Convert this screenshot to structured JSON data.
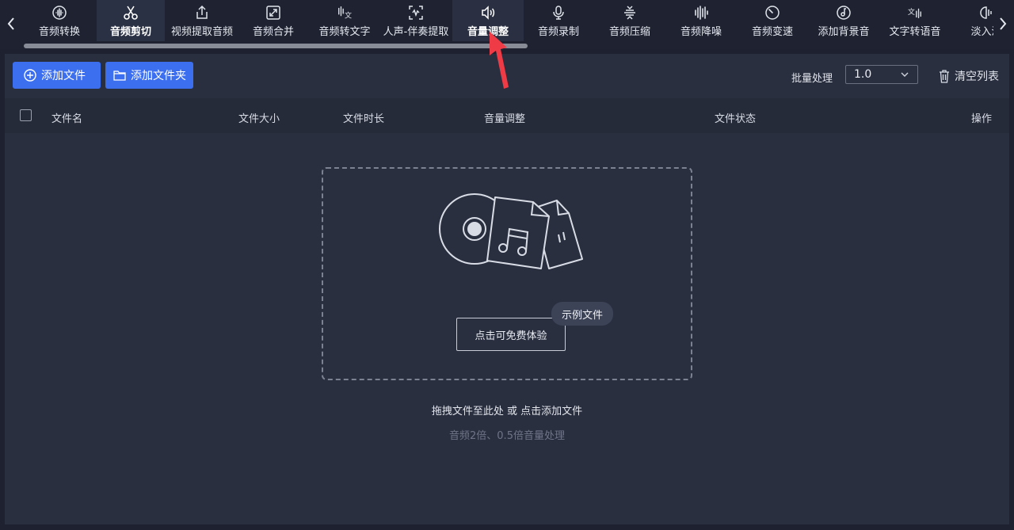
{
  "toolbar": {
    "tabs": [
      {
        "label": "音频转换",
        "icon": "waveform-circle-icon"
      },
      {
        "label": "音频剪切",
        "icon": "scissors-icon"
      },
      {
        "label": "视频提取音频",
        "icon": "share-upload-icon"
      },
      {
        "label": "音频合并",
        "icon": "merge-arrows-icon"
      },
      {
        "label": "音频转文字",
        "icon": "voice-to-text-icon"
      },
      {
        "label": "人声-伴奏提取",
        "icon": "vocal-extract-icon"
      },
      {
        "label": "音量调整",
        "icon": "speaker-volume-icon"
      },
      {
        "label": "音频录制",
        "icon": "microphone-icon"
      },
      {
        "label": "音频压缩",
        "icon": "compress-icon"
      },
      {
        "label": "音频降噪",
        "icon": "noise-bars-icon"
      },
      {
        "label": "音频变速",
        "icon": "speedometer-icon"
      },
      {
        "label": "添加背景音",
        "icon": "music-disc-icon"
      },
      {
        "label": "文字转语音",
        "icon": "text-to-speech-icon"
      },
      {
        "label": "淡入淡",
        "icon": "fade-icon"
      }
    ],
    "active_tab": "音频剪切",
    "hovered_tab": "音量调整"
  },
  "actions": {
    "add_file": "添加文件",
    "add_folder": "添加文件夹",
    "batch_label": "批量处理",
    "batch_value": "1.0",
    "clear_list": "清空列表"
  },
  "table": {
    "columns": [
      "文件名",
      "文件大小",
      "文件时长",
      "音量调整",
      "文件状态",
      "操作"
    ]
  },
  "dropzone": {
    "try_button": "点击可免费体验",
    "sample_badge": "示例文件",
    "hint": "拖拽文件至此处 或 点击添加文件",
    "subhint": "音频2倍、0.5倍音量处理"
  },
  "colors": {
    "accent": "#3b6ff0",
    "background": "#1e2230",
    "panel": "#2a2f40",
    "annotation_arrow": "#ef3b45"
  }
}
